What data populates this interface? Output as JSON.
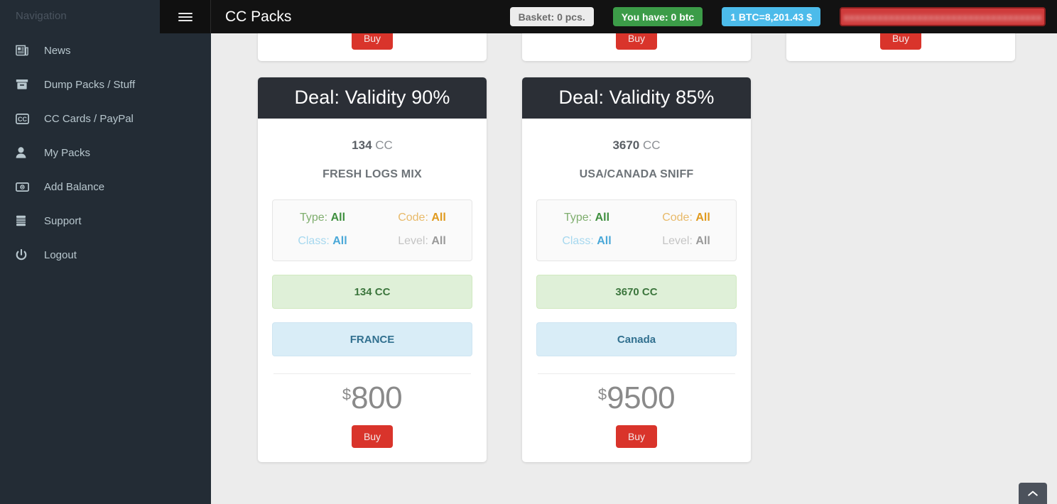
{
  "sidebar": {
    "title": "Navigation",
    "items": [
      {
        "label": "News",
        "icon": "newspaper-icon"
      },
      {
        "label": "Dump Packs / Stuff",
        "icon": "archive-icon"
      },
      {
        "label": "CC Cards / PayPal",
        "icon": "cc-icon"
      },
      {
        "label": "My Packs",
        "icon": "user-icon"
      },
      {
        "label": "Add Balance",
        "icon": "money-bill-icon"
      },
      {
        "label": "Support",
        "icon": "server-icon"
      },
      {
        "label": "Logout",
        "icon": "power-off-icon"
      }
    ]
  },
  "header": {
    "menu_icon": "hamburger-icon",
    "title": "CC Packs",
    "badges": {
      "basket": "Basket: 0 pcs.",
      "balance": "You have: 0 btc",
      "rate": "1 BTC=8,201.43 $",
      "redacted": "xxxxxxxxxxxxxxxxxxxxxxxxxxxxxxxxxxx"
    },
    "colors": {
      "basket_bg": "#ececec",
      "balance_bg": "#3c9c48",
      "rate_bg": "#4cbbea",
      "redacted_bg": "#cf3b3b"
    }
  },
  "main": {
    "partial_cards": [
      {
        "buy_label": "Buy"
      },
      {
        "buy_label": "Buy"
      },
      {
        "buy_label": "Buy"
      }
    ],
    "cards": [
      {
        "title": "Deal: Validity 90%",
        "cc_number": "134",
        "cc_unit": "CC",
        "pack_name": "FRESH LOGS MIX",
        "attrs": {
          "type_label": "Type:",
          "type_value": "All",
          "code_label": "Code:",
          "code_value": "All",
          "class_label": "Class:",
          "class_value": "All",
          "level_label": "Level:",
          "level_value": "All"
        },
        "quantity_pill": "134 CC",
        "country_pill": "FRANCE",
        "currency": "$",
        "price": "800",
        "buy_label": "Buy"
      },
      {
        "title": "Deal: Validity 85%",
        "cc_number": "3670",
        "cc_unit": "CC",
        "pack_name": "USA/CANADA SNIFF",
        "attrs": {
          "type_label": "Type:",
          "type_value": "All",
          "code_label": "Code:",
          "code_value": "All",
          "class_label": "Class:",
          "class_value": "All",
          "level_label": "Level:",
          "level_value": "All"
        },
        "quantity_pill": "3670 CC",
        "country_pill": "Canada",
        "currency": "$",
        "price": "9500",
        "buy_label": "Buy"
      }
    ]
  },
  "scroll_top": {
    "icon": "chevron-up-icon"
  }
}
